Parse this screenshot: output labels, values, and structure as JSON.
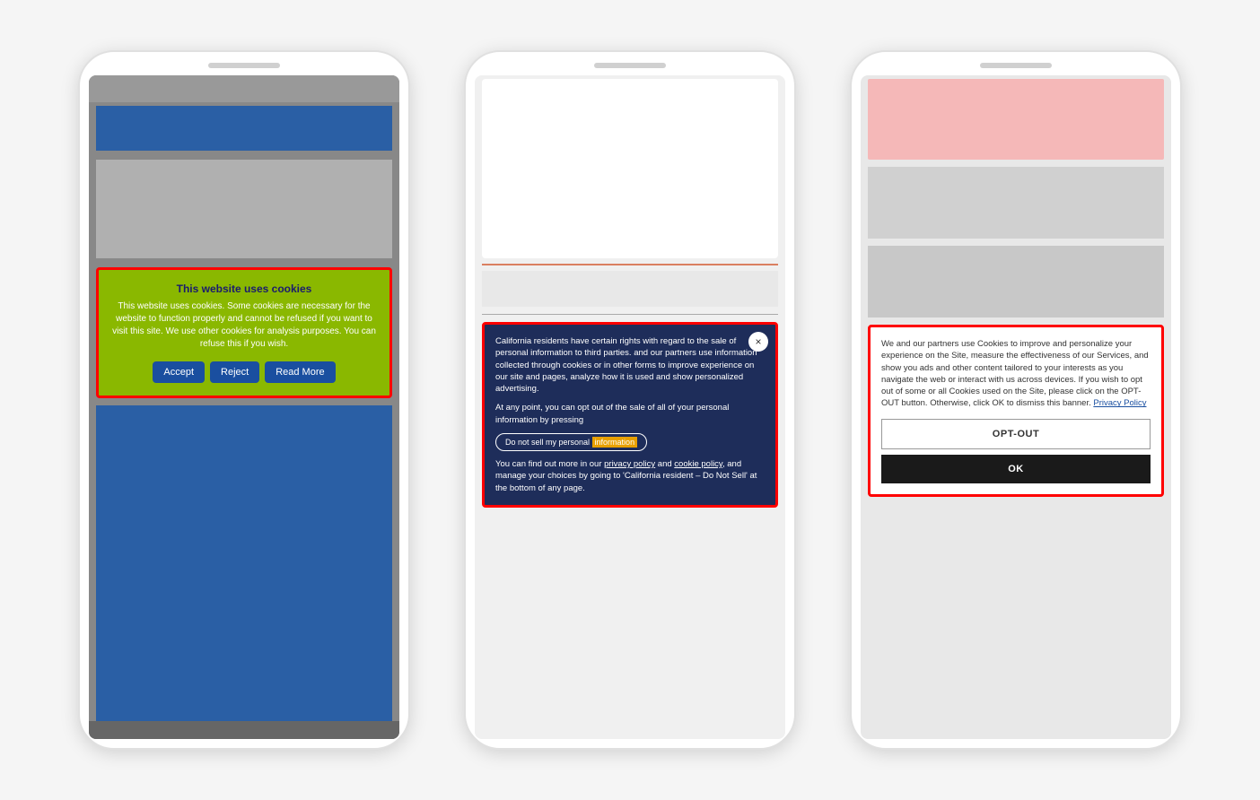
{
  "page": {
    "background": "#f5f5f5"
  },
  "phone1": {
    "cookie": {
      "title": "This website uses cookies",
      "body": "This website uses cookies. Some cookies are necessary for the website to function properly and cannot be refused if you want to visit this site. We use other cookies for analysis purposes. You can refuse this if you wish.",
      "accept_label": "Accept",
      "reject_label": "Reject",
      "read_more_label": "Read More"
    }
  },
  "phone2": {
    "close_icon": "×",
    "cookie": {
      "body1": "California residents have certain rights with regard to the sale of personal information to third parties.",
      "body2": "and our partners use information collected through cookies or in other forms to improve experience on our site and pages, analyze how it is used and show personalized advertising.",
      "body3": "At any point, you can opt out of the sale of all of your personal information by pressing",
      "do_not_sell_label": "Do not sell my personal information",
      "body4": "You can find out more in our",
      "privacy_policy_label": "privacy policy",
      "and_label": "and",
      "cookie_policy_label": "cookie policy",
      "body5": ", and manage your choices by going to 'California resident – Do Not Sell' at the bottom of any page."
    }
  },
  "phone3": {
    "cookie": {
      "body": "We and our partners use Cookies to improve and personalize your experience on the Site, measure the effectiveness of our Services, and show you ads and other content tailored to your interests as you navigate the web or interact with us across devices. If you wish to opt out of some or all Cookies used on the Site, please click on the OPT-OUT button. Otherwise, click OK to dismiss this banner.",
      "privacy_policy_label": "Privacy Policy",
      "opt_out_label": "OPT-OUT",
      "ok_label": "OK"
    }
  }
}
